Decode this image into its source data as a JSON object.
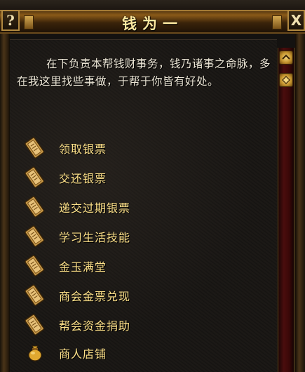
{
  "window": {
    "title": "钱为一",
    "help_label": "?",
    "close_label": "X"
  },
  "dialog": {
    "intro": "在下负责本帮钱财事务，钱乃诸事之命脉，多在我这里找些事做，于帮于你皆有好处。"
  },
  "options": [
    {
      "label": "领取银票",
      "icon": "scroll-icon"
    },
    {
      "label": "交还银票",
      "icon": "scroll-icon"
    },
    {
      "label": "递交过期银票",
      "icon": "scroll-icon"
    },
    {
      "label": "学习生活技能",
      "icon": "scroll-icon"
    },
    {
      "label": "金玉满堂",
      "icon": "scroll-icon"
    },
    {
      "label": "商会金票兑现",
      "icon": "scroll-icon"
    },
    {
      "label": "帮会资金捐助",
      "icon": "scroll-icon"
    },
    {
      "label": "商人店铺",
      "icon": "money-bag-icon"
    }
  ],
  "colors": {
    "title_text": "#ffe9a0",
    "option_text": "#ffe28a",
    "body_text": "#ece6d6",
    "frame_gold": "#b08840",
    "scrollbar_red": "#4a0d0d"
  }
}
